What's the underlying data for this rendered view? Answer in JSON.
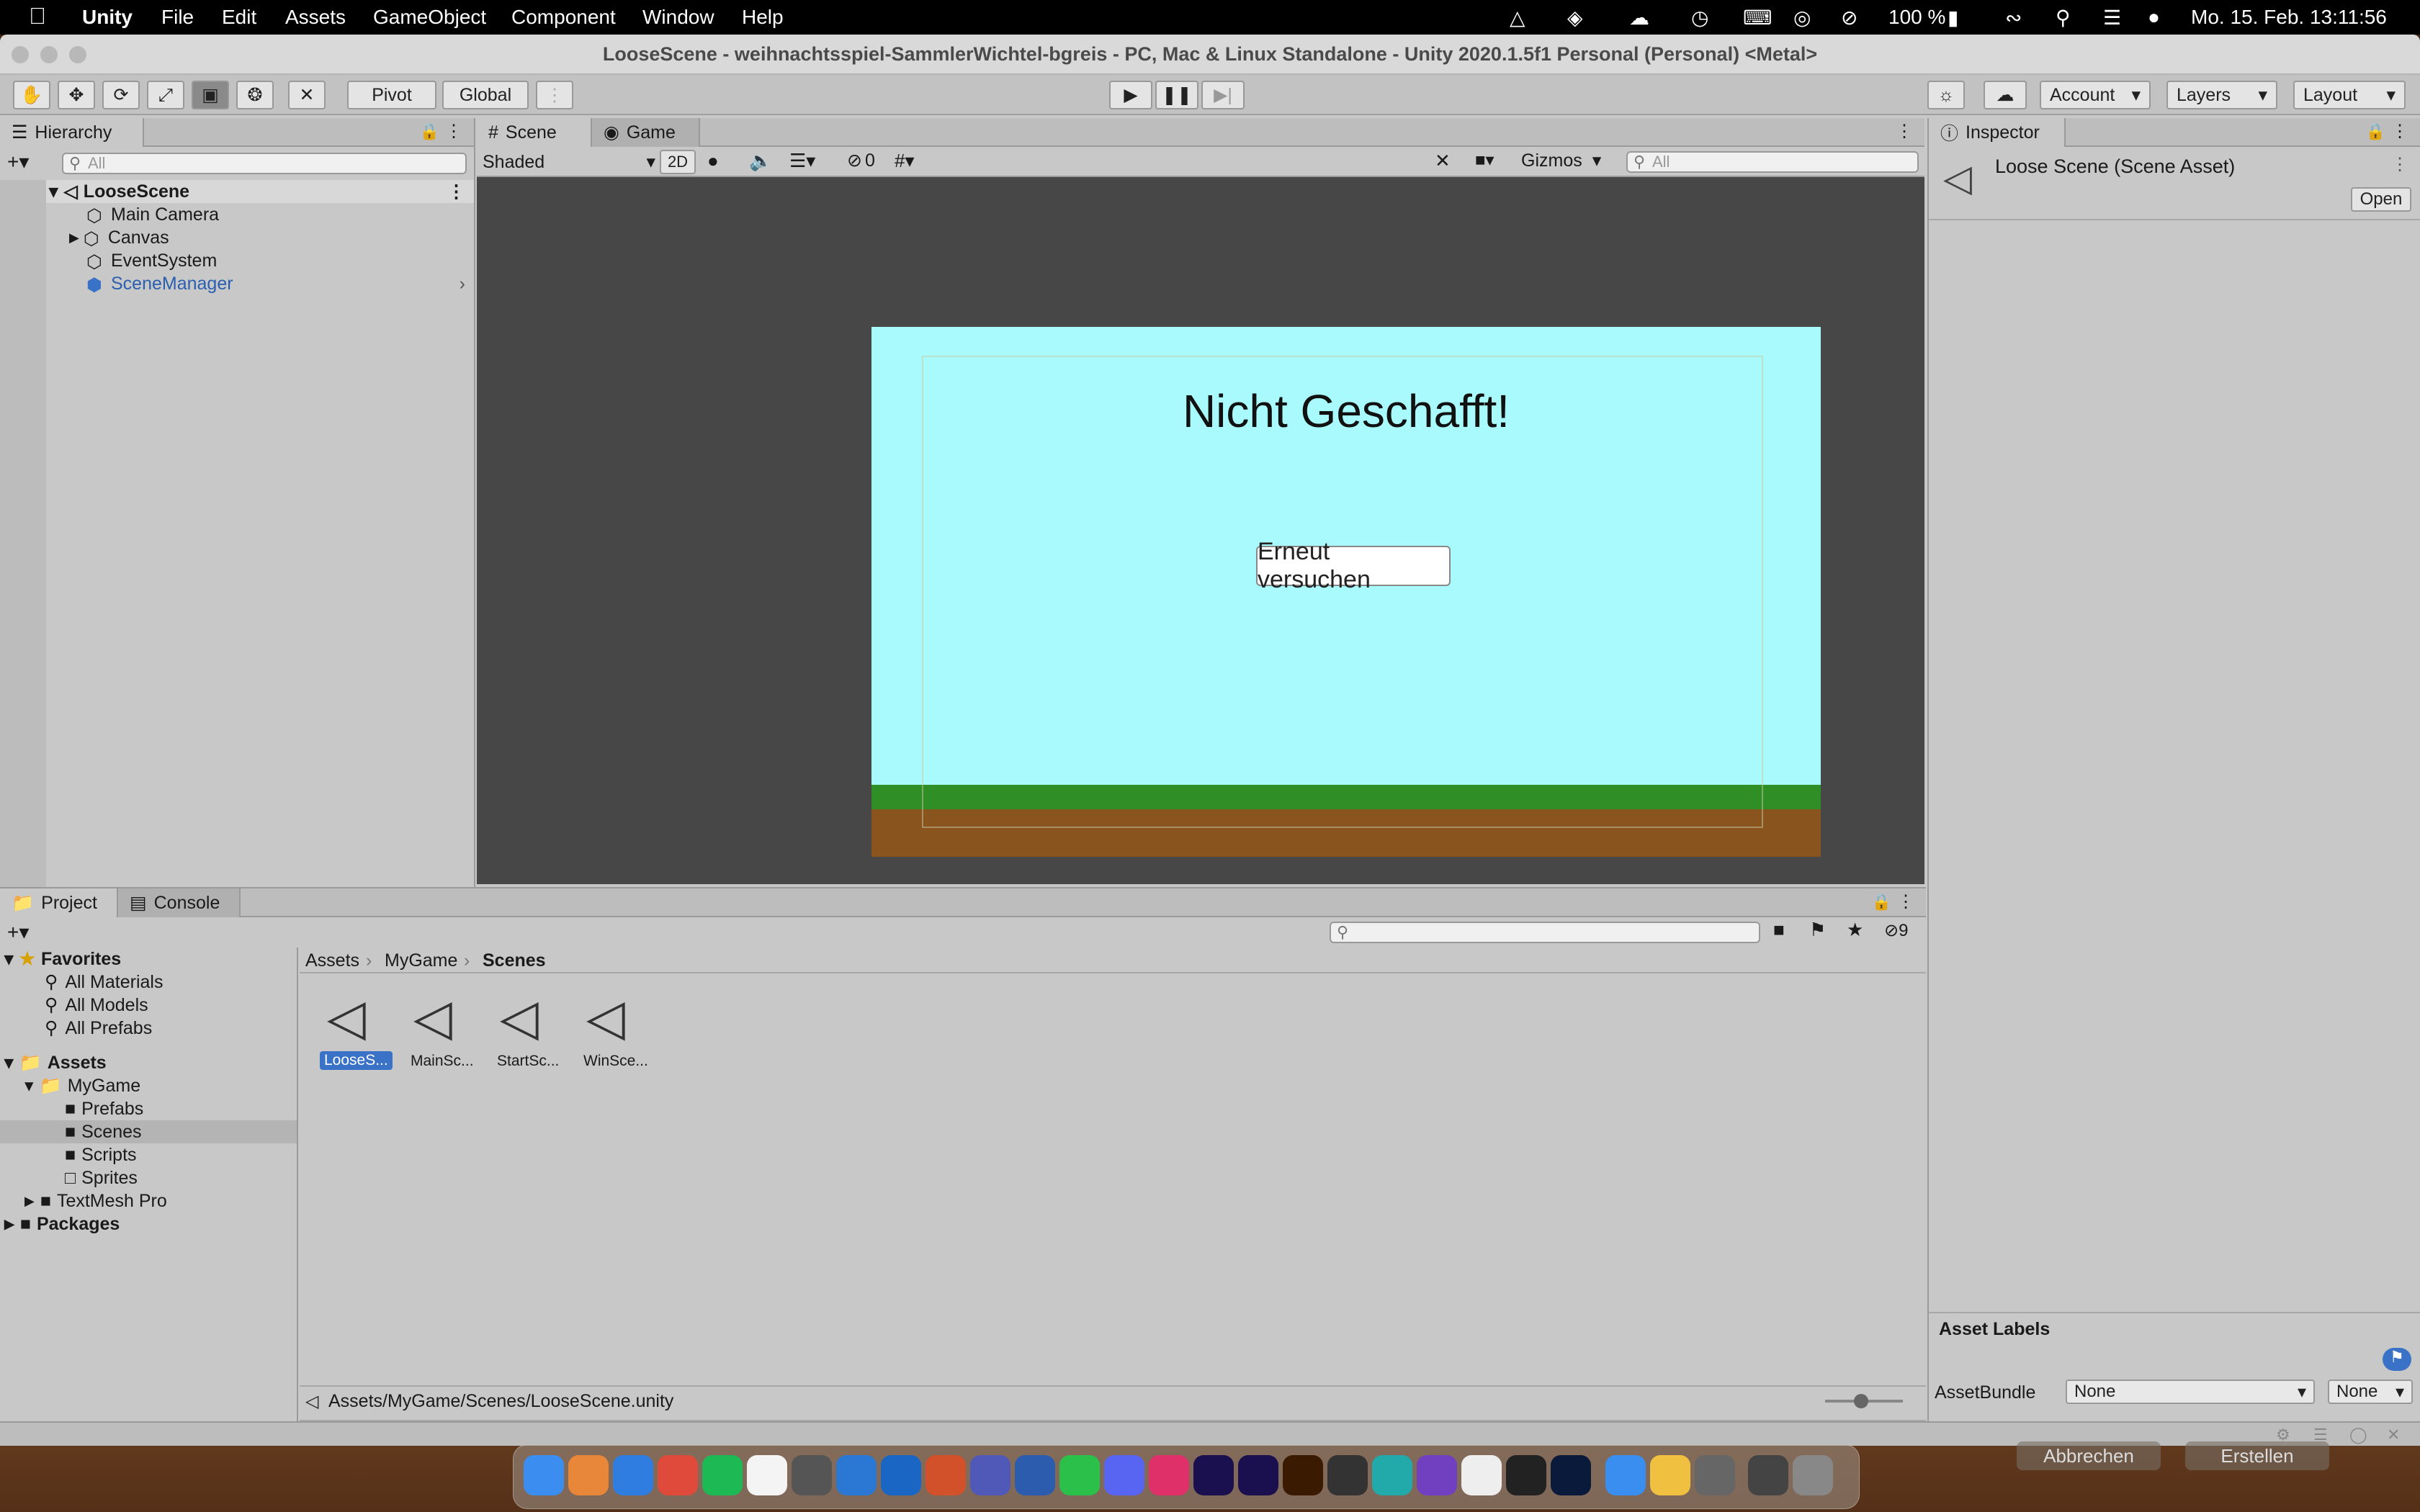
{
  "menubar": {
    "app": "Unity",
    "items": [
      "File",
      "Edit",
      "Assets",
      "GameObject",
      "Component",
      "Window",
      "Help"
    ],
    "battery": "100 %",
    "clock": "Mo. 15. Feb.  13:11:56"
  },
  "window": {
    "title": "LooseScene - weihnachtsspiel-SammlerWichtel-bgreis - PC, Mac & Linux Standalone - Unity 2020.1.5f1 Personal (Personal) <Metal>"
  },
  "toolbar": {
    "pivot": "Pivot",
    "global": "Global",
    "account": "Account",
    "layers": "Layers",
    "layout": "Layout"
  },
  "hierarchy": {
    "tab": "Hierarchy",
    "search_placeholder": "All",
    "scene": "LooseScene",
    "items": [
      "Main Camera",
      "Canvas",
      "EventSystem",
      "SceneManager"
    ]
  },
  "scene": {
    "tabs": [
      "Scene",
      "Game"
    ],
    "shading": "Shaded",
    "mode2d": "2D",
    "hidden_count": "0",
    "gizmos": "Gizmos",
    "search_placeholder": "All"
  },
  "game": {
    "headline": "Nicht Geschafft!",
    "retry_button": "Erneut versuchen"
  },
  "inspector": {
    "tab": "Inspector",
    "asset_title": "Loose Scene (Scene Asset)",
    "open_button": "Open",
    "asset_labels": "Asset Labels",
    "assetbundle_label": "AssetBundle",
    "assetbundle_value": "None",
    "assetbundle_variant": "None"
  },
  "project": {
    "tabs": [
      "Project",
      "Console"
    ],
    "favorites": "Favorites",
    "favorite_items": [
      "All Materials",
      "All Models",
      "All Prefabs"
    ],
    "assets": "Assets",
    "mygame": "MyGame",
    "folders": [
      "Prefabs",
      "Scenes",
      "Scripts",
      "Sprites"
    ],
    "textmeshpro": "TextMesh Pro",
    "packages": "Packages",
    "breadcrumb": [
      "Assets",
      "MyGame",
      "Scenes"
    ],
    "files": [
      "LooseS...",
      "MainSc...",
      "StartSc...",
      "WinSce..."
    ],
    "hidden_count": "9",
    "status_path": "Assets/MyGame/Scenes/LooseScene.unity"
  },
  "dialog_behind": {
    "cancel": "Abbrechen",
    "create": "Erstellen"
  },
  "colors": {
    "sky": "#a8fafc",
    "grass": "#2f8e25",
    "dirt": "#8a541e",
    "selection": "#3a72c8"
  }
}
